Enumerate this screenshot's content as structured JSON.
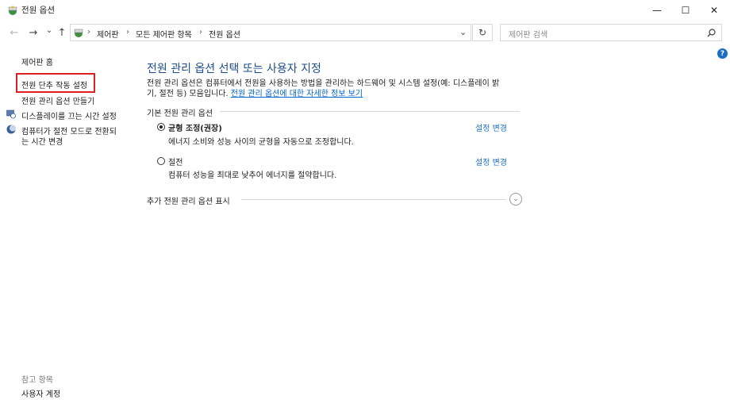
{
  "window": {
    "title": "전원 옵션",
    "minimize": "—",
    "maximize": "☐",
    "close": "✕"
  },
  "nav": {
    "back": "←",
    "forward": "→",
    "recent": "⌄",
    "up": "↑"
  },
  "address": {
    "crumbs": [
      "제어판",
      "모든 제어판 항목",
      "전원 옵션"
    ],
    "separator": "›",
    "dropdown": "⌄",
    "refresh": "↻"
  },
  "search": {
    "placeholder": "제어판 검색"
  },
  "help": {
    "label": "?"
  },
  "sidebar": {
    "home": "제어판 홈",
    "items": [
      {
        "label": "전원 단추 작동 설정"
      },
      {
        "label": "전원 관리 옵션 만들기"
      },
      {
        "label": "디스플레이를 끄는 시간 설정"
      },
      {
        "label_line1": "컴퓨터가 절전 모드로 전환되",
        "label_line2": "는 시간 변경"
      }
    ],
    "see_also": "참고 항목",
    "see_also_items": [
      "사용자 계정"
    ]
  },
  "main": {
    "heading": "전원 관리 옵션 선택 또는 사용자 지정",
    "desc_line1": "전원 관리 옵션은 컴퓨터에서 전원을 사용하는 방법을 관리하는 하드웨어 및 시스템 설정(예: 디스플레이 밝",
    "desc_line2_prefix": "기, 절전 등) 모음입니다.",
    "desc_link": "전원 관리 옵션에 대한 자세한 정보 보기",
    "section_title": "기본 전원 관리 옵션",
    "plans": [
      {
        "name": "균형 조정(권장)",
        "selected": true,
        "description": "에너지 소비와 성능 사이의 균형을 자동으로 조정합니다.",
        "change_link": "설정 변경"
      },
      {
        "name": "절전",
        "selected": false,
        "description": "컴퓨터 성능을 최대로 낮추어 에너지를 절약합니다.",
        "change_link": "설정 변경"
      }
    ],
    "more_plans": "추가 전원 관리 옵션 표시",
    "expand": "⌄"
  },
  "colors": {
    "heading": "#1e4e8c",
    "link": "#1a6fc4",
    "highlight_box": "#e02020"
  }
}
